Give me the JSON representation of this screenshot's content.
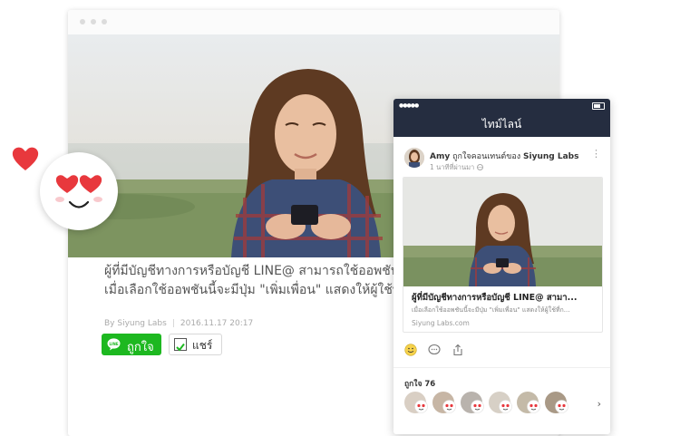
{
  "article": {
    "title_line1": "ผู้ที่มีบัญชีทางการหรือบัญชี LINE@ สามารถใช้ออพชันเพิ่มเ",
    "title_line2": "เมื่อเลือกใช้ออพชันนี้จะมีปุ่ม \"เพิ่มเพื่อน\" แสดงให้ผู้ใช้ที่กดถ",
    "author": "By Siyung Labs",
    "date": "2016.11.17 20:17",
    "like_label": "ถูกใจ",
    "share_label": "แชร์"
  },
  "phone": {
    "nav_title": "ไทม์ไลน์",
    "post_author": "Amy",
    "post_action": " ถูกใจคอนเทนต์ของ ",
    "post_target": "Siyung Labs",
    "post_time": "1 นาทีที่ผ่านมา",
    "card_title": "ผู้ที่มีบัญชีทางการหรือบัญชี LINE@ สามา...",
    "card_desc": "เมื่อเลือกใช้ออพชันนี้จะมีปุ่ม \"เพิ่มเพื่อน\" แสดงให้ผู้ใช้ที่ก...",
    "card_domain": "Siyung Labs.com",
    "likes_label": "ถูกใจ 76",
    "more_label": "⋮",
    "chevron_label": "›"
  },
  "colors": {
    "line_green": "#1db820",
    "navbar": "#252d40",
    "heart_red": "#e8383d"
  }
}
